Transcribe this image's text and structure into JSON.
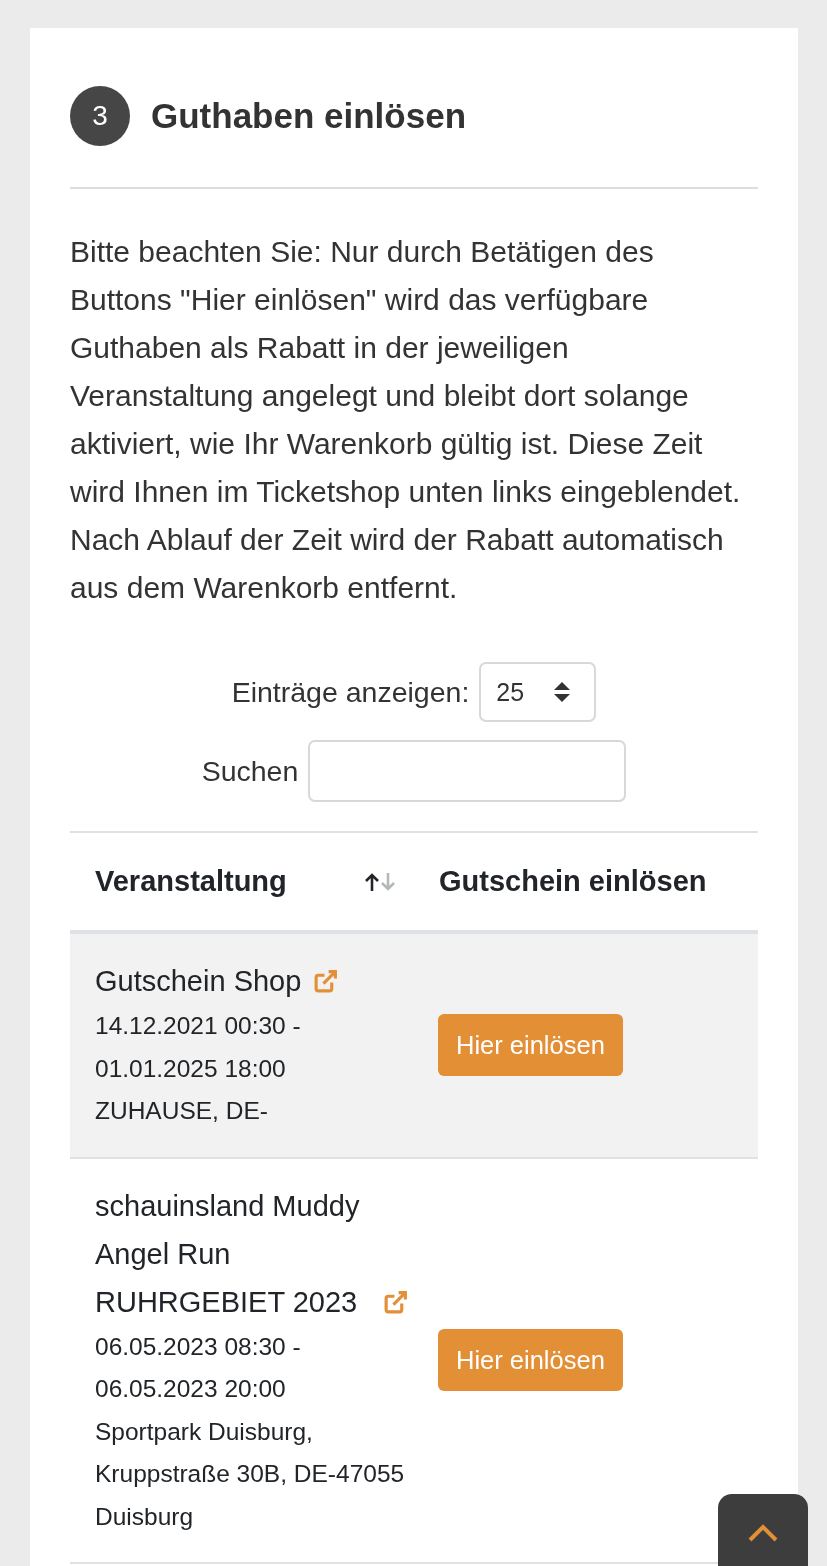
{
  "section": {
    "step": "3",
    "title": "Guthaben einlösen",
    "notice": "Bitte beachten Sie: Nur durch Betätigen des Buttons \"Hier einlösen\" wird das verfügbare Guthaben als Rabatt in der jeweiligen Veranstaltung angelegt und bleibt dort solange aktiviert, wie Ihr Warenkorb gültig ist. Diese Zeit wird Ihnen im Ticketshop unten links eingeblendet. Nach Ablauf der Zeit wird der Rabatt automatisch aus dem Warenkorb entfernt."
  },
  "table_controls": {
    "length_label": "Einträge anzeigen:",
    "length_value": "25",
    "search_label": "Suchen"
  },
  "table": {
    "columns": [
      {
        "label": "Veranstaltung",
        "sorted": true,
        "descending": false
      },
      {
        "label": "Gutschein einlösen"
      }
    ],
    "rows": [
      {
        "event": "Gutschein Shop",
        "dates": "14.12.2021 00:30 - 01.01.2025 18:00",
        "location": "ZUHAUSE, DE-",
        "action": "Hier einlösen"
      },
      {
        "event": "schauinsland Muddy Angel Run RUHRGEBIET 2023",
        "dates": "06.05.2023 08:30 - 06.05.2023 20:00",
        "location": "Sportpark Duisburg, Kruppstraße 30B, DE-47055 Duisburg",
        "action": "Hier einlösen"
      }
    ]
  }
}
